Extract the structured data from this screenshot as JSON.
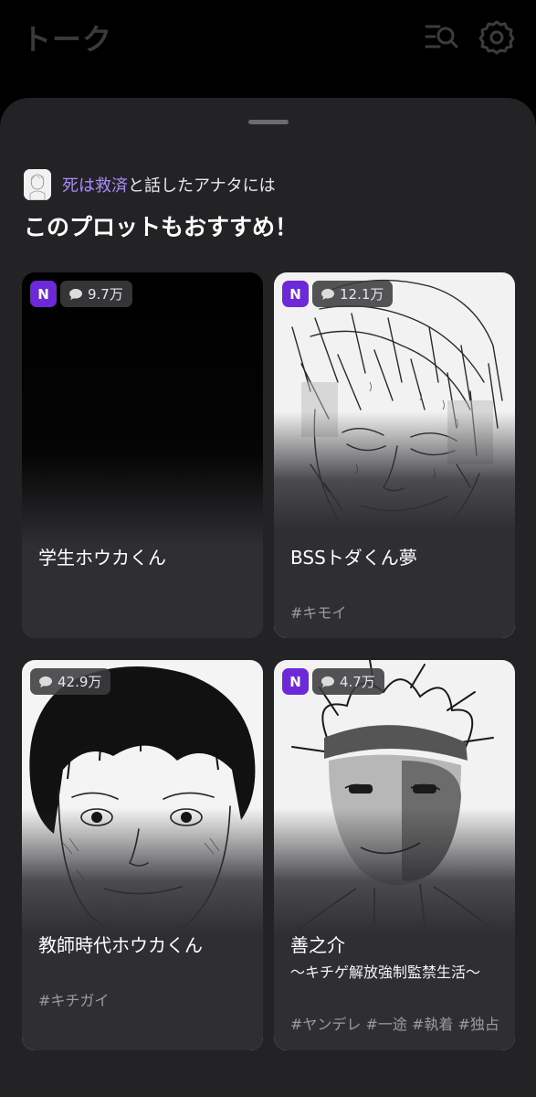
{
  "header": {
    "title": "トーク",
    "icons": [
      "search-list-icon",
      "gear-icon"
    ]
  },
  "sheet": {
    "reference": {
      "highlight": "死は救済",
      "suffix": "と話したアナタには"
    },
    "title": "このプロットもおすすめ！"
  },
  "colors": {
    "accent": "#a78bfa",
    "badge_new": "#6d28d9",
    "sheet_bg": "#232326",
    "card_bg": "#2f2f33"
  },
  "cards": [
    {
      "new_badge": "N",
      "chat_count": "9.7万",
      "title": "学生ホウカくん",
      "subtitle": "",
      "tags": ""
    },
    {
      "new_badge": "N",
      "chat_count": "12.1万",
      "title": "BSSトダくん夢",
      "subtitle": "",
      "tags": "#キモイ"
    },
    {
      "new_badge": "",
      "chat_count": "42.9万",
      "title": "教師時代ホウカくん",
      "subtitle": "",
      "tags": "#キチガイ"
    },
    {
      "new_badge": "N",
      "chat_count": "4.7万",
      "title": "善之介",
      "subtitle": "～キチゲ解放強制監禁生活～",
      "tags": "#ヤンデレ #一途 #執着 #独占"
    }
  ]
}
